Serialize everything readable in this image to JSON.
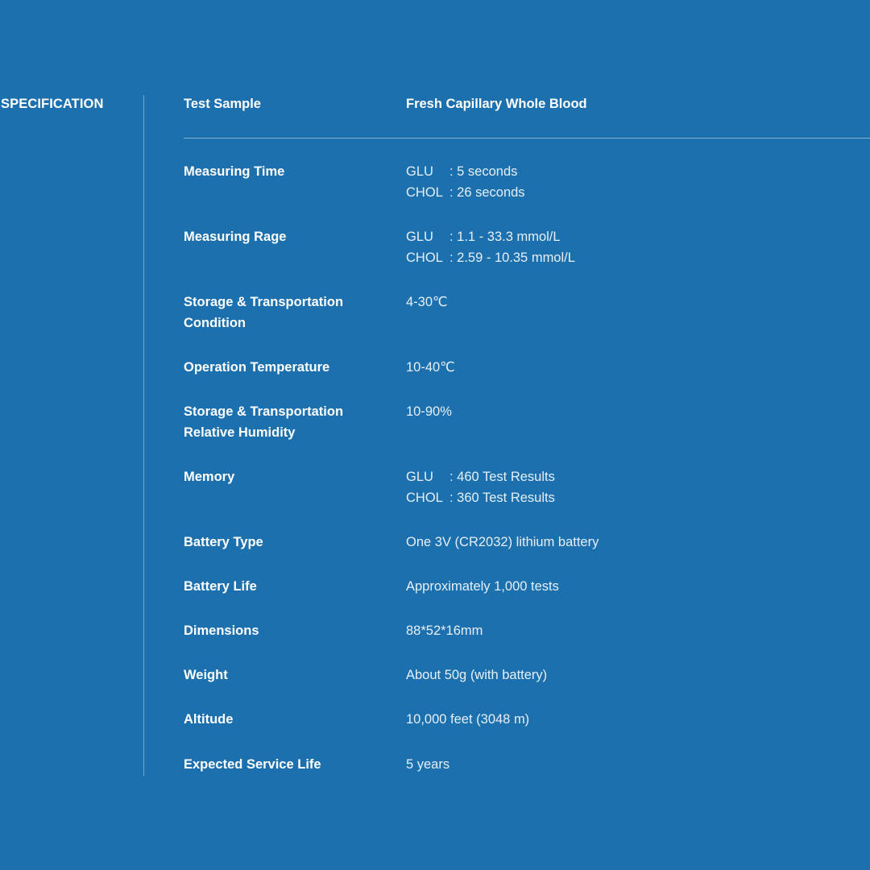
{
  "section_title": "SPECIFICATION",
  "specs": [
    {
      "label": [
        "Test Sample"
      ],
      "value": "Fresh Capillary Whole Blood"
    },
    {
      "label": [
        "Measuring Time"
      ],
      "lines": [
        {
          "code": "GLU",
          "text": ": 5 seconds"
        },
        {
          "code": "CHOL",
          "text": ": 26 seconds"
        }
      ]
    },
    {
      "label": [
        "Measuring Rage"
      ],
      "lines": [
        {
          "code": "GLU",
          "text": ": 1.1 - 33.3 mmol/L"
        },
        {
          "code": "CHOL",
          "text": ": 2.59 - 10.35 mmol/L"
        }
      ]
    },
    {
      "label": [
        "Storage & Transportation",
        "Condition"
      ],
      "value": "4-30℃"
    },
    {
      "label": [
        "Operation Temperature"
      ],
      "value": "10-40℃"
    },
    {
      "label": [
        "Storage & Transportation",
        "Relative Humidity"
      ],
      "value": "10-90%"
    },
    {
      "label": [
        "Memory"
      ],
      "lines": [
        {
          "code": "GLU",
          "text": ": 460 Test Results"
        },
        {
          "code": "CHOL",
          "text": ": 360 Test Results"
        }
      ]
    },
    {
      "label": [
        "Battery Type"
      ],
      "value": "One 3V (CR2032) lithium battery"
    },
    {
      "label": [
        "Battery Life"
      ],
      "value": "Approximately 1,000 tests"
    },
    {
      "label": [
        "Dimensions"
      ],
      "value": "88*52*16mm"
    },
    {
      "label": [
        "Weight"
      ],
      "value": "About 50g (with battery)"
    },
    {
      "label": [
        "Altitude"
      ],
      "value": "10,000 feet (3048 m)"
    },
    {
      "label": [
        "Expected Service Life"
      ],
      "value": "5 years"
    }
  ],
  "colors": {
    "background": "#1c70ae",
    "text": "#ffffff"
  }
}
